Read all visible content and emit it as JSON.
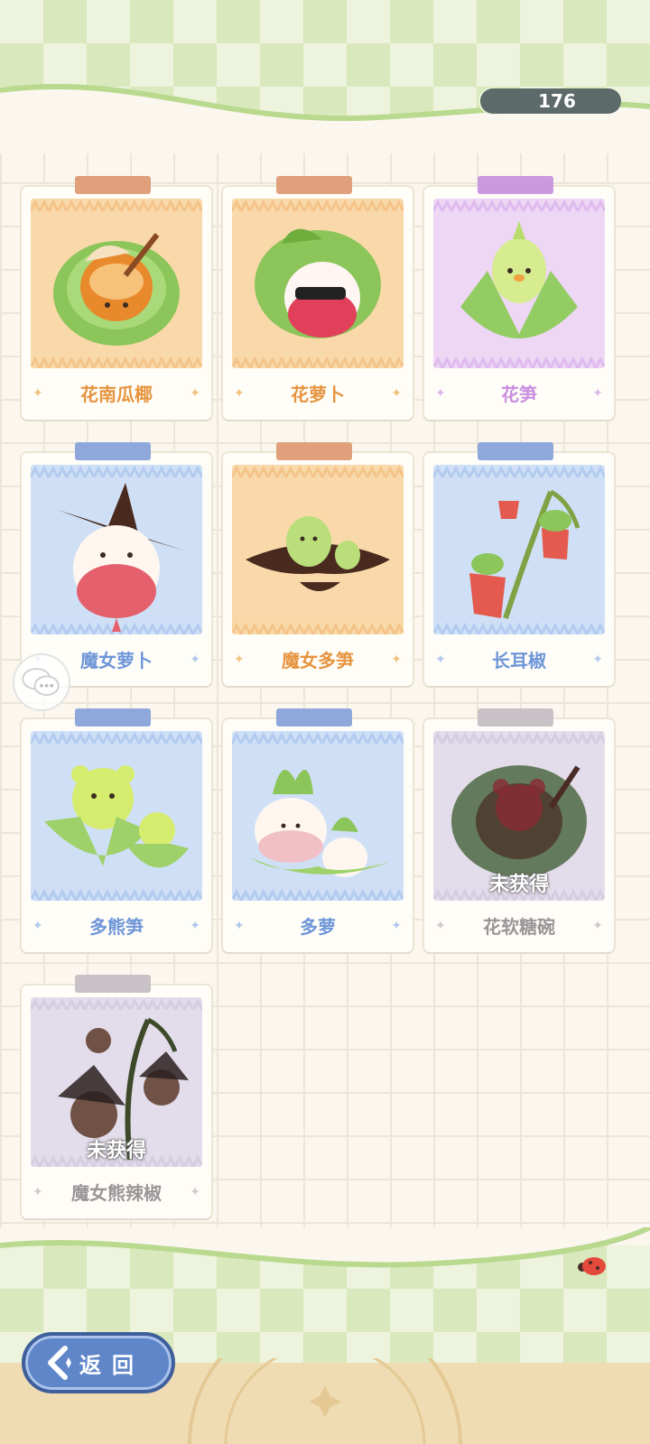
{
  "currency": {
    "amount": "176",
    "icon": "leaf-coin-icon"
  },
  "cards": [
    {
      "name": "花南瓜椰",
      "theme": "orange",
      "locked": false,
      "art": "pumpkin-coconut-icon"
    },
    {
      "name": "花萝卜",
      "theme": "orange",
      "locked": false,
      "art": "radish-sunglasses-icon"
    },
    {
      "name": "花笋",
      "theme": "purple",
      "locked": false,
      "art": "bamboo-shoot-icon"
    },
    {
      "name": "魔女萝卜",
      "theme": "blue",
      "locked": false,
      "art": "witch-radish-icon"
    },
    {
      "name": "魔女多笋",
      "theme": "orange",
      "locked": false,
      "art": "witch-shoots-icon"
    },
    {
      "name": "长耳椒",
      "theme": "blue",
      "locked": false,
      "art": "long-ear-pepper-icon"
    },
    {
      "name": "多熊笋",
      "theme": "blue",
      "locked": false,
      "art": "bear-shoots-icon"
    },
    {
      "name": "多萝",
      "theme": "blue",
      "locked": false,
      "art": "twin-radish-icon"
    },
    {
      "name": "花软糖碗",
      "theme": "gray",
      "locked": true,
      "art": "gummy-bowl-icon"
    },
    {
      "name": "魔女熊辣椒",
      "theme": "gray",
      "locked": true,
      "art": "witch-bear-pepper-icon"
    }
  ],
  "locked_label": "未获得",
  "back_button": {
    "label": "返回"
  }
}
